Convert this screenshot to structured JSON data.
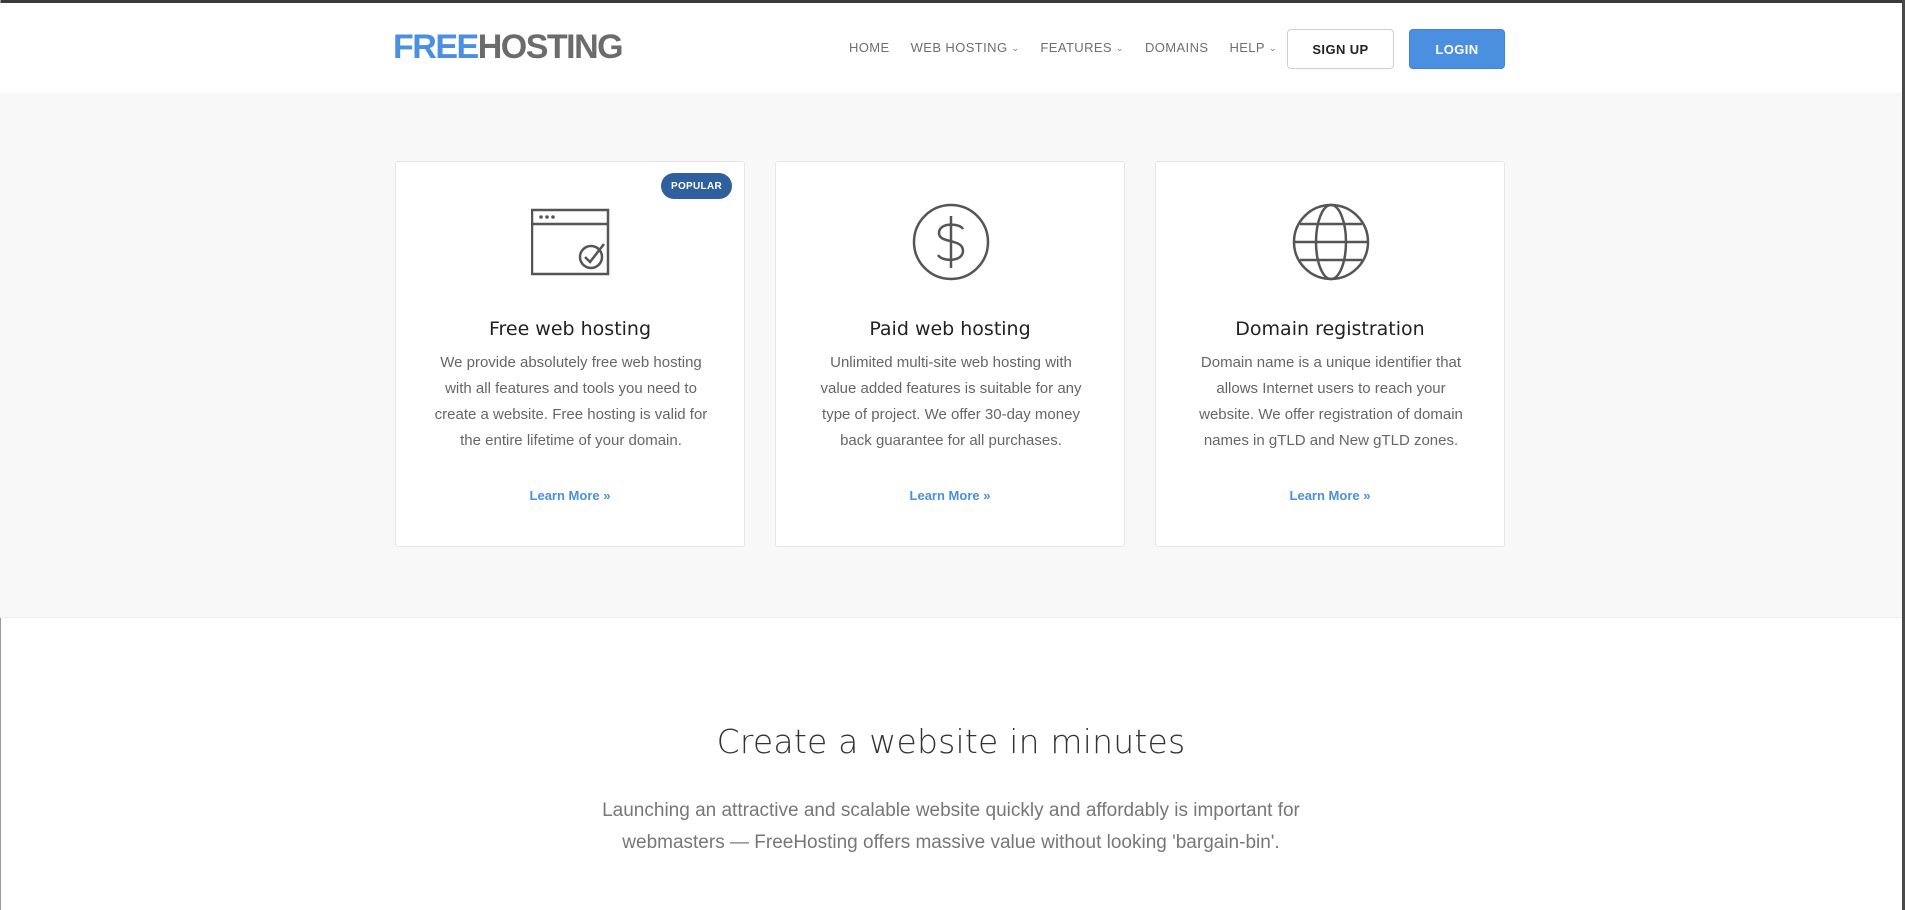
{
  "brand": {
    "logo_part1": "FREE",
    "logo_part2": "HOSTING"
  },
  "nav": {
    "items": [
      {
        "label": "HOME",
        "has_dropdown": false
      },
      {
        "label": "WEB HOSTING",
        "has_dropdown": true
      },
      {
        "label": "FEATURES",
        "has_dropdown": true
      },
      {
        "label": "DOMAINS",
        "has_dropdown": false
      },
      {
        "label": "HELP",
        "has_dropdown": true
      }
    ],
    "signup_label": "SIGN UP",
    "login_label": "LOGIN"
  },
  "cards": [
    {
      "icon": "browser-check-icon",
      "badge": "POPULAR",
      "title": "Free web hosting",
      "description": "We provide absolutely free web hosting with all features and tools you need to create a website. Free hosting is valid for the entire lifetime of your domain.",
      "link": "Learn More »"
    },
    {
      "icon": "dollar-icon",
      "title": "Paid web hosting",
      "description": "Unlimited multi-site web hosting with value added features is suitable for any type of project. We offer 30-day money back guarantee for all purchases.",
      "link": "Learn More »"
    },
    {
      "icon": "globe-icon",
      "title": "Domain registration",
      "description": "Domain name is a unique identifier that allows Internet users to reach your website. We offer registration of domain names in gTLD and New gTLD zones.",
      "link": "Learn More »"
    }
  ],
  "cta": {
    "title": "Create a website in minutes",
    "subtitle": "Launching an attractive and scalable website quickly and affordably is important for webmasters — FreeHosting offers massive value without looking 'bargain-bin'."
  },
  "colors": {
    "accent": "#4a8fe0",
    "badge": "#2f5f9c",
    "logo_gray": "#6b6b6b"
  }
}
